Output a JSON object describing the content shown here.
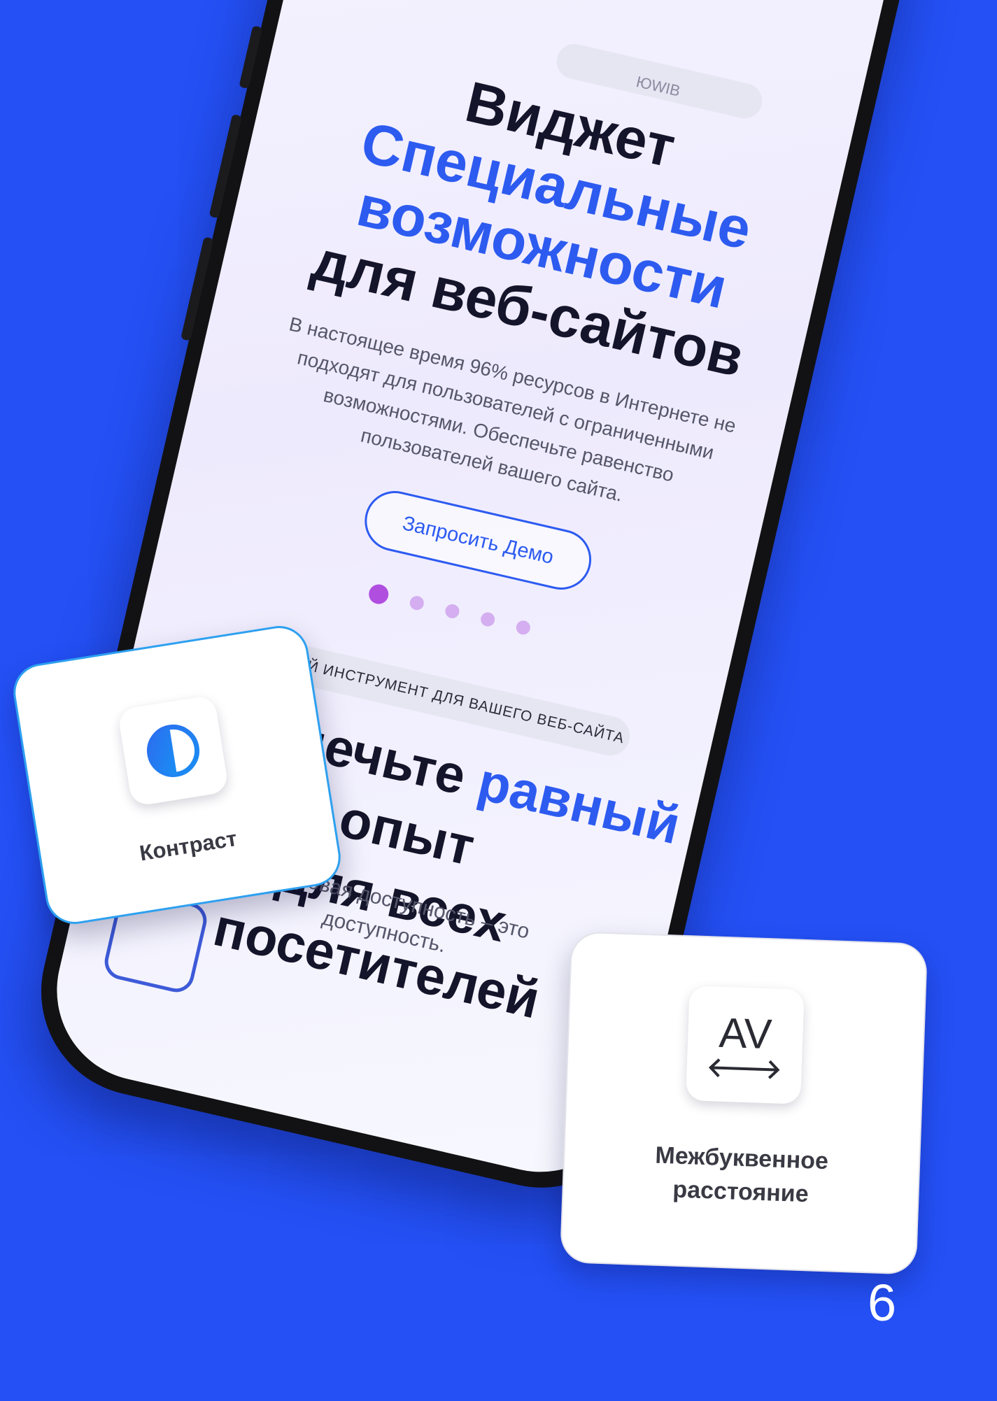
{
  "colors": {
    "background": "#2450f5",
    "accent_blue": "#2d5bf0",
    "dot_active": "#b04ee0",
    "dot_inactive": "#d4aef0",
    "card_border_contrast": "#2da0f0"
  },
  "phone": {
    "top_pill_text": "ЮWIB",
    "hero": {
      "line1": "Виджет",
      "line2": "Специальные",
      "line3": "возможности",
      "line4": "для веб-сайтов"
    },
    "description": "В настоящее время 96% ресурсов в Интернете не подходят для пользователей с ограниченными возможностями. Обеспечьте равенство пользователей вашего сайта.",
    "demo_button": "Запросить Демо",
    "carousel": {
      "total": 5,
      "active_index": 0
    },
    "section2": {
      "pill": "ЛУЧШИЙ ИНСТРУМЕНТ ДЛЯ ВАШЕГО ВЕБ-САЙТА",
      "title_part1": "Обеспечьте ",
      "title_highlight": "равный",
      "title_part2": " опыт",
      "title_line2": "для всех посетителей",
      "description_line1": "Цифровая доступность – это",
      "description_line2": "доступность."
    }
  },
  "cards": {
    "contrast": {
      "label": "Контраст",
      "icon": "contrast-icon"
    },
    "letter_spacing": {
      "label_line1": "Межбуквенное",
      "label_line2": "расстояние",
      "icon_text": "AV",
      "icon": "letter-spacing-icon"
    }
  },
  "page_number": "6"
}
